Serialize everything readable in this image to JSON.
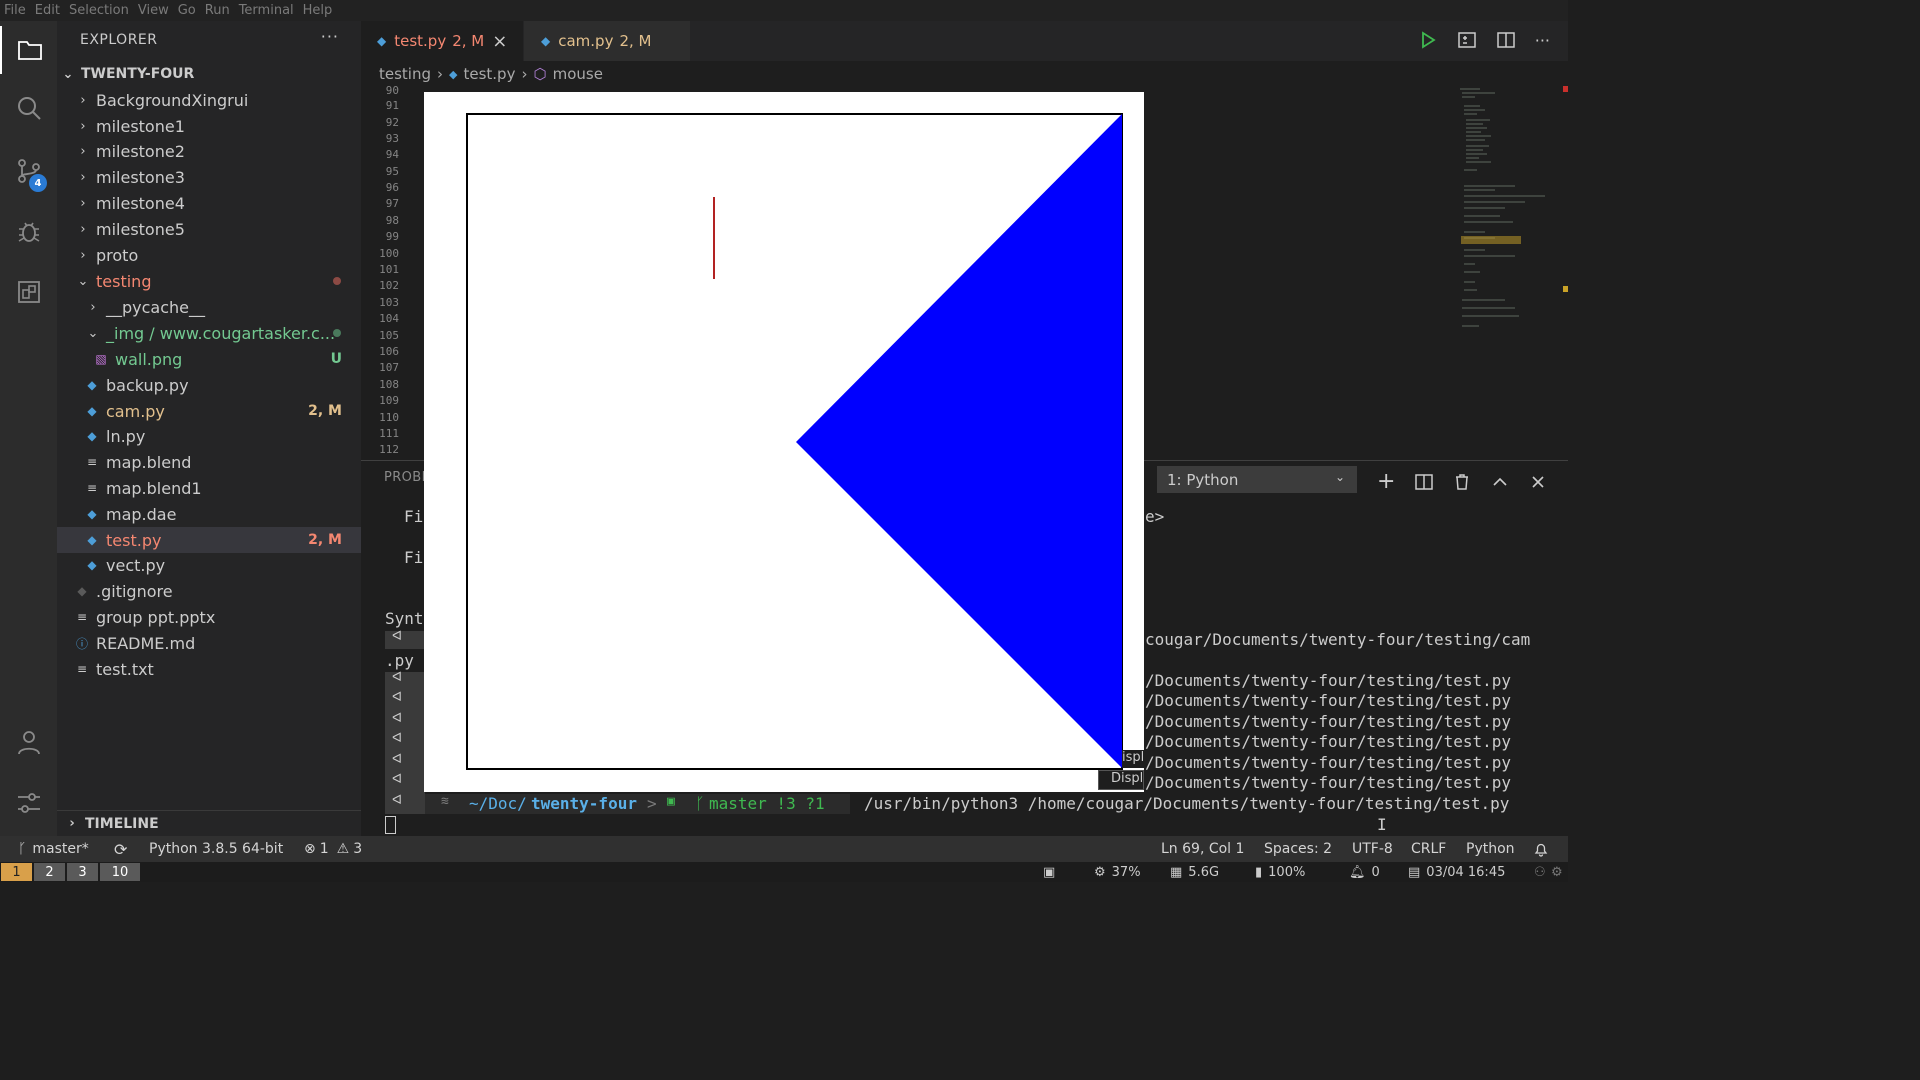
{
  "menu": [
    "File",
    "Edit",
    "Selection",
    "View",
    "Go",
    "Run",
    "Terminal",
    "Help"
  ],
  "activity": {
    "scm_badge": "4"
  },
  "explorer": {
    "title": "EXPLORER",
    "more": "···",
    "workspace": "TWENTY-FOUR",
    "items": [
      {
        "label": "BackgroundXingrui",
        "kind": "folder"
      },
      {
        "label": "milestone1",
        "kind": "folder"
      },
      {
        "label": "milestone2",
        "kind": "folder"
      },
      {
        "label": "milestone3",
        "kind": "folder"
      },
      {
        "label": "milestone4",
        "kind": "folder"
      },
      {
        "label": "milestone5",
        "kind": "folder"
      },
      {
        "label": "proto",
        "kind": "folder"
      },
      {
        "label": "testing",
        "kind": "folder-open"
      },
      {
        "label": "__pycache__",
        "kind": "folder"
      },
      {
        "label": "_img / www.cougartasker.c...",
        "kind": "folder-open"
      },
      {
        "label": "wall.png",
        "kind": "image",
        "badge": "U"
      },
      {
        "label": "backup.py",
        "kind": "python"
      },
      {
        "label": "cam.py",
        "kind": "python",
        "badge": "2, M"
      },
      {
        "label": "ln.py",
        "kind": "python"
      },
      {
        "label": "map.blend",
        "kind": "text"
      },
      {
        "label": "map.blend1",
        "kind": "text"
      },
      {
        "label": "map.dae",
        "kind": "python"
      },
      {
        "label": "test.py",
        "kind": "python",
        "badge": "2, M"
      },
      {
        "label": "vect.py",
        "kind": "python"
      },
      {
        "label": ".gitignore",
        "kind": "git"
      },
      {
        "label": "group ppt.pptx",
        "kind": "text"
      },
      {
        "label": "README.md",
        "kind": "info"
      },
      {
        "label": "test.txt",
        "kind": "text"
      }
    ],
    "timeline": "TIMELINE"
  },
  "tabs": [
    {
      "label": "test.py",
      "badge": "2, M",
      "close": "×"
    },
    {
      "label": "cam.py",
      "badge": "2, M"
    }
  ],
  "breadcrumb": {
    "folder": "testing",
    "file": "test.py",
    "symbol": "mouse"
  },
  "gutter": [
    "90",
    "91",
    "92",
    "93",
    "94",
    "95",
    "96",
    "97",
    "98",
    "99",
    "100",
    "101",
    "102",
    "103",
    "104",
    "105",
    "106",
    "107",
    "108",
    "109",
    "110",
    "111",
    "112"
  ],
  "panel": {
    "title": "PROBL",
    "terminal_select": "1: Python",
    "lines": {
      "l1": "Fi",
      "l2": "Fi",
      "l3": "Synt",
      "l4": ".py",
      "e1": "e>",
      "cam": "cougar/Documents/twenty-four/testing/cam",
      "path": "/Documents/twenty-four/testing/test.py",
      "prompt_dir": "~/Doc/",
      "prompt_repo": "twenty-four",
      "prompt_branch": "master !3 ?1",
      "cmd": "/usr/bin/python3 /home/cougar/Documents/twenty-four/testing/test.py",
      "disp1": "ispl",
      "disp2": "Displ"
    }
  },
  "status": {
    "branch": "master*",
    "python": "Python 3.8.5 64-bit",
    "errors": "1",
    "warnings": "3",
    "position": "Ln 69, Col 1",
    "spaces": "Spaces: 2",
    "encoding": "UTF-8",
    "eol": "CRLF",
    "language": "Python"
  },
  "wm": {
    "workspaces": [
      "1",
      "2",
      "3",
      "10"
    ],
    "cpu": "37%",
    "mem": "5.6G",
    "battery": "100%",
    "notif": "0",
    "datetime": "03/04 16:45"
  },
  "colors": {
    "accent": "#2a7bd5",
    "modified": "#e2c08d",
    "error_file": "#f48771",
    "untracked": "#73c991",
    "triangle": "#0000ff",
    "cursor_line": "#b22222"
  }
}
